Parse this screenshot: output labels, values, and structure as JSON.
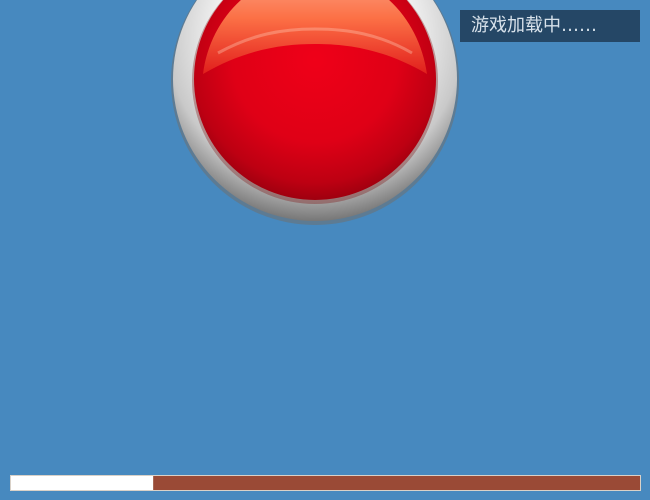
{
  "game": {
    "loading_text": "游戏加载中……",
    "progress_fraction": 0.227
  },
  "visuals": {
    "background_color": "#4789bf",
    "button_icon": "red-glossy-button-icon",
    "button_color": "#e40016",
    "ring_color": "#d8d8d8",
    "progress_fill_color": "#ffffff",
    "progress_track_color": "#9a4a36",
    "label_background_color": "#254766"
  }
}
